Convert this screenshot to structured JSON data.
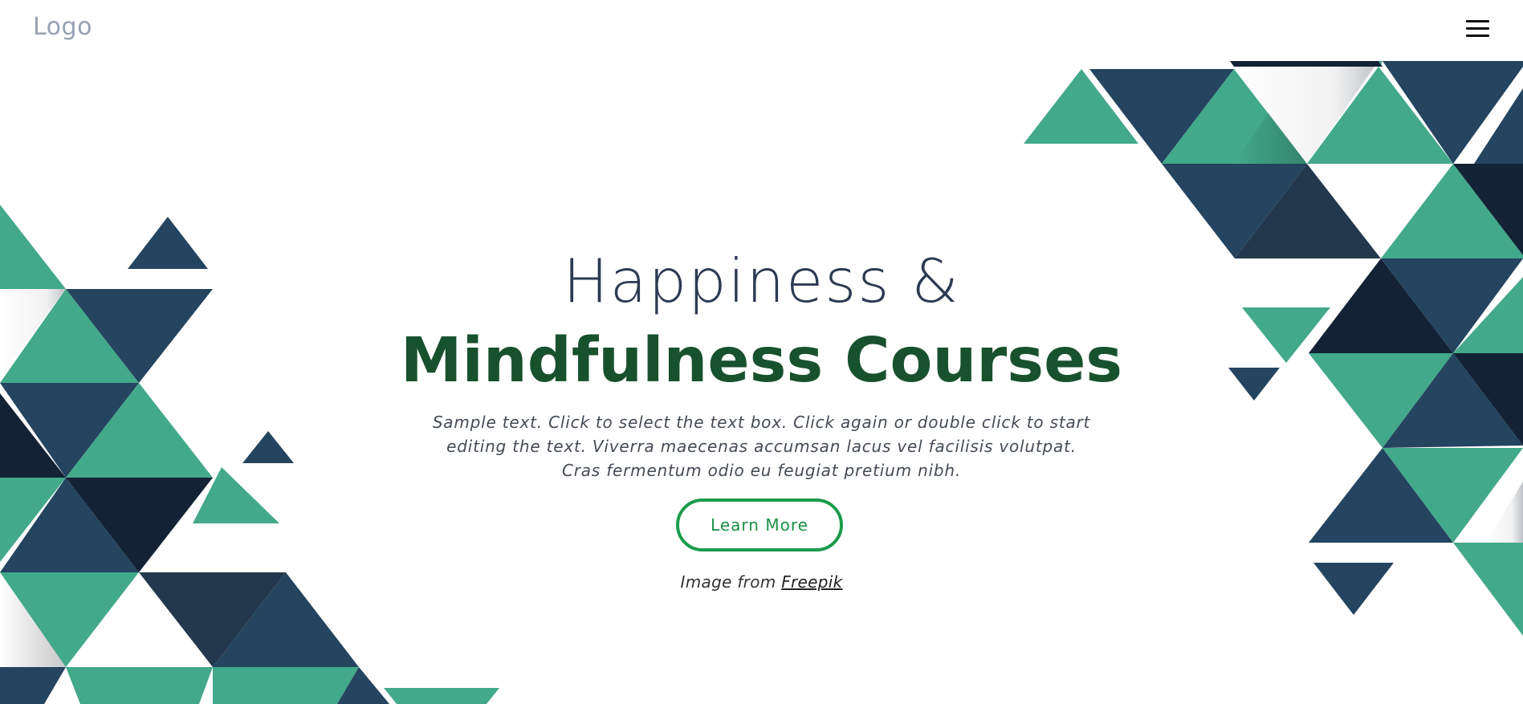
{
  "header": {
    "logo_text": "Logo",
    "menu_icon": "hamburger-menu-icon"
  },
  "hero": {
    "title_line1": "Happiness &",
    "title_line2": "Mindfulness Courses",
    "description": "Sample text. Click to select the text box. Click again or double click to start editing the text. Viverra maecenas accumsan lacus vel facilisis volutpat. Cras fermentum odio eu feugiat pretium nibh.",
    "cta_label": "Learn More",
    "credit_prefix": "Image from",
    "credit_link": "Freepik"
  },
  "colors": {
    "teal": "#42a98a",
    "navy": "#24445f",
    "dark_navy": "#132235",
    "title_dark": "#2d3a53",
    "title_green": "#18512e",
    "button_green": "#1a9c4c",
    "logo_gray": "#97a1b3"
  }
}
